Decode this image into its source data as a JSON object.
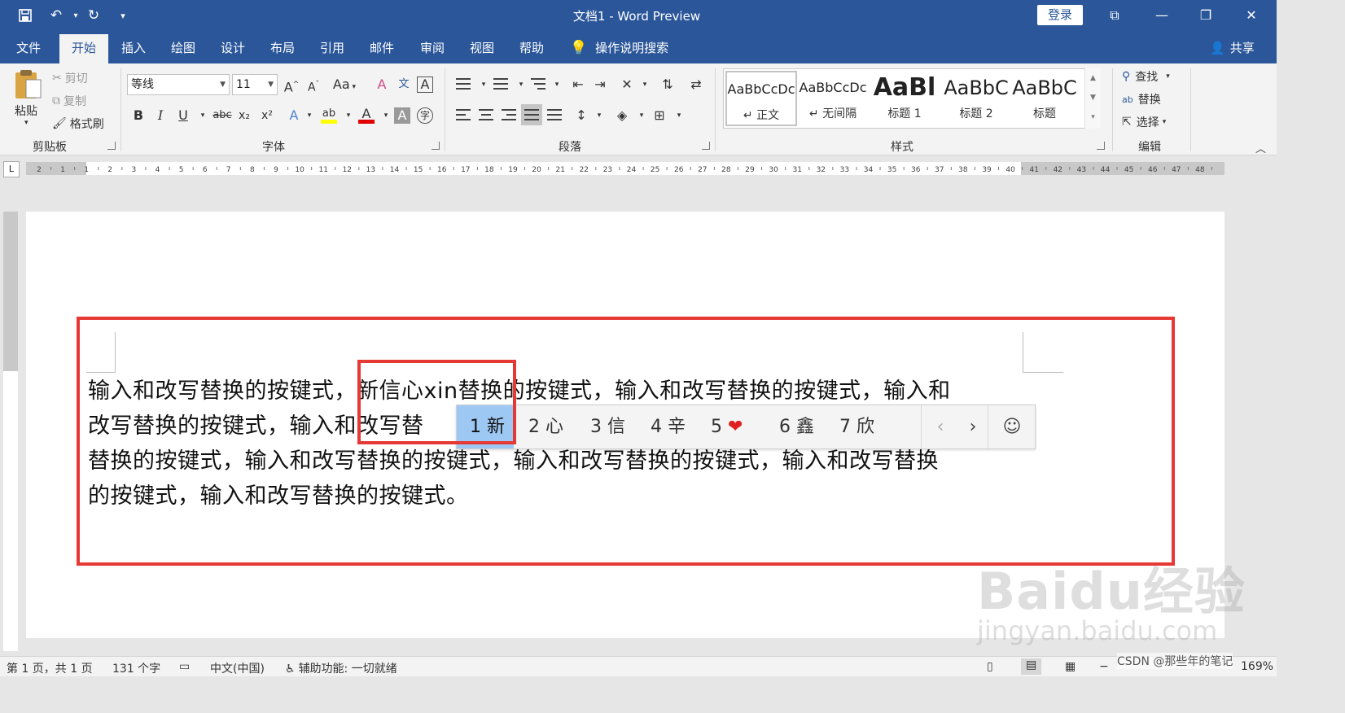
{
  "window": {
    "title": "文档1 - Word Preview",
    "login_label": "登录",
    "controls": [
      "⧉",
      "—",
      "❐",
      "✕"
    ]
  },
  "quick_access": [
    "save-icon",
    "undo-icon",
    "redo-icon",
    "customize-icon"
  ],
  "tabs": [
    {
      "label": "文件"
    },
    {
      "label": "开始",
      "active": true
    },
    {
      "label": "插入"
    },
    {
      "label": "绘图"
    },
    {
      "label": "设计"
    },
    {
      "label": "布局"
    },
    {
      "label": "引用"
    },
    {
      "label": "邮件"
    },
    {
      "label": "审阅"
    },
    {
      "label": "视图"
    },
    {
      "label": "帮助"
    }
  ],
  "tell_me": "操作说明搜索",
  "share": "共享",
  "clipboard": {
    "group_label": "剪贴板",
    "paste": "粘贴",
    "cut": "剪切",
    "copy": "复制",
    "format_painter": "格式刷"
  },
  "font": {
    "group_label": "字体",
    "family": "等线",
    "size": "11",
    "grow": "A",
    "shrink": "A",
    "case": "Aa",
    "clear": "A",
    "phonetic": "文",
    "border_char": "A",
    "bold": "B",
    "italic": "I",
    "underline": "U",
    "strike": "abc",
    "subscript": "x₂",
    "superscript": "x²",
    "effects": "A",
    "highlight": "ab",
    "color": "A",
    "shading": "A",
    "enclose": "字"
  },
  "paragraph": {
    "group_label": "段落"
  },
  "styles": {
    "group_label": "样式",
    "items": [
      {
        "sample": "AaBbCcDc",
        "name": "↵ 正文",
        "selected": true
      },
      {
        "sample": "AaBbCcDc",
        "name": "↵ 无间隔"
      },
      {
        "sample": "AaBl",
        "name": "标题 1"
      },
      {
        "sample": "AaBbC",
        "name": "标题 2"
      },
      {
        "sample": "AaBbC",
        "name": "标题"
      }
    ]
  },
  "editing": {
    "group_label": "编辑",
    "find": "查找",
    "replace": "替换",
    "select": "选择"
  },
  "ruler": {
    "corner": "L",
    "ticks": [
      "2",
      "1",
      "1",
      "2",
      "3",
      "4",
      "5",
      "6",
      "7",
      "8",
      "9",
      "10",
      "11",
      "12",
      "13",
      "14",
      "15",
      "16",
      "17",
      "18",
      "19",
      "20",
      "21",
      "22",
      "23",
      "24",
      "25",
      "26",
      "27",
      "28",
      "29",
      "30",
      "31",
      "32",
      "33",
      "34",
      "35",
      "36",
      "37",
      "38",
      "39",
      "40",
      "41",
      "42",
      "43",
      "44",
      "45",
      "46",
      "47",
      "48"
    ]
  },
  "document": {
    "lines": [
      "输入和改写替换的按键式，新信心xin替换的按键式，输入和改写替换的按键式，输入和",
      "改写替换的按键式，输入和改写替",
      "替换的按键式，输入和改写替换的按键式，输入和改写替换的按键式，输入和改写替换",
      "的按键式，输入和改写替换的按键式。"
    ]
  },
  "ime": {
    "candidates": [
      {
        "num": "1",
        "text": "新",
        "selected": true
      },
      {
        "num": "2",
        "text": "心"
      },
      {
        "num": "3",
        "text": "信"
      },
      {
        "num": "4",
        "text": "辛"
      },
      {
        "num": "5",
        "text": "❤"
      },
      {
        "num": "6",
        "text": "鑫"
      },
      {
        "num": "7",
        "text": "欣"
      }
    ],
    "prev": "‹",
    "next": "›",
    "emoji": "☺"
  },
  "status": {
    "page": "第 1 页，共 1 页",
    "words": "131 个字",
    "language": "中文(中国)",
    "accessibility": "辅助功能: 一切就绪",
    "zoom": "169%"
  },
  "watermarks": {
    "baidu": "Baidu经验",
    "jingyan": "jingyan.baidu.com",
    "csdn": "CSDN @那些年的笔记"
  },
  "colors": {
    "brand": "#2b579a",
    "highlight_box": "#e53935",
    "ime_selected": "#9ec8f4",
    "font_color_bar": "#e00000",
    "highlight_bar": "#ffff00"
  }
}
